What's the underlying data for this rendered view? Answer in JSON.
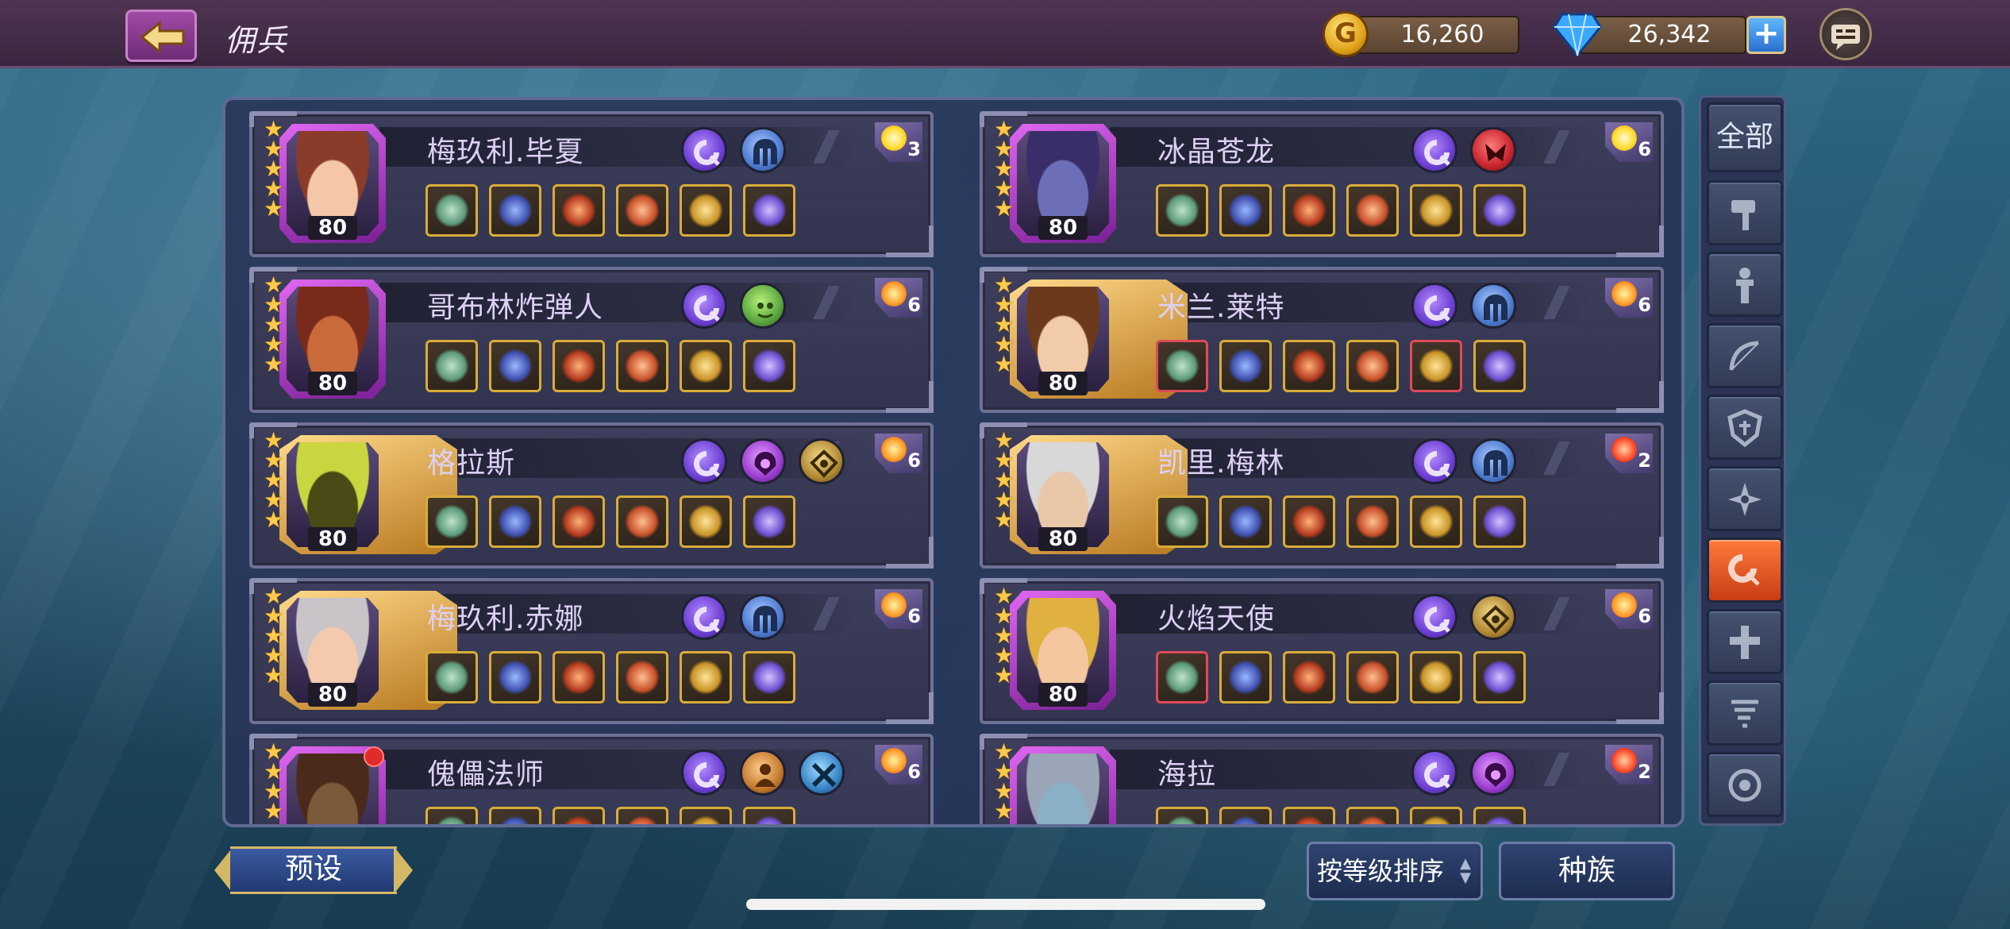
{
  "header": {
    "title": "佣兵",
    "gold": "16,260",
    "gems": "26,342",
    "plus_label": "+"
  },
  "heroes": [
    {
      "name": "梅玖利.毕夏",
      "level": "80",
      "stars": 5,
      "frame": "purple",
      "skin": "#f4c7a6",
      "hair": "#8a3b2a",
      "classes": [
        "purple",
        "blue"
      ],
      "badge": {
        "num": "3",
        "color": "yellow"
      },
      "equip_red": [],
      "dot": false
    },
    {
      "name": "冰晶苍龙",
      "level": "80",
      "stars": 5,
      "frame": "purple",
      "skin": "#6c6fb8",
      "hair": "#3a2e6a",
      "classes": [
        "purple",
        "red"
      ],
      "badge": {
        "num": "6",
        "color": "yellow"
      },
      "equip_red": [],
      "dot": false
    },
    {
      "name": "哥布林炸弹人",
      "level": "80",
      "stars": 5,
      "frame": "purple",
      "skin": "#c86a3a",
      "hair": "#7a2a1a",
      "classes": [
        "purple",
        "green"
      ],
      "badge": {
        "num": "6",
        "color": "orange"
      },
      "equip_red": [],
      "dot": false
    },
    {
      "name": "米兰.莱特",
      "level": "80",
      "stars": 5,
      "frame": "gold",
      "skin": "#f2cbaa",
      "hair": "#6b3a1c",
      "classes": [
        "purple",
        "blue"
      ],
      "badge": {
        "num": "6",
        "color": "orange"
      },
      "equip_red": [
        0,
        4
      ],
      "dot": false
    },
    {
      "name": "格拉斯",
      "level": "80",
      "stars": 5,
      "frame": "gold",
      "skin": "#4a4a16",
      "hair": "#c9d640",
      "classes": [
        "purple",
        "pink",
        "gold"
      ],
      "badge": {
        "num": "6",
        "color": "orange"
      },
      "equip_red": [],
      "dot": false
    },
    {
      "name": "凯里.梅林",
      "level": "80",
      "stars": 5,
      "frame": "gold",
      "skin": "#e8c8a8",
      "hair": "#d8d8d8",
      "classes": [
        "purple",
        "blue"
      ],
      "badge": {
        "num": "2",
        "color": "red"
      },
      "equip_red": [],
      "dot": false
    },
    {
      "name": "梅玖利.赤娜",
      "level": "80",
      "stars": 5,
      "frame": "gold",
      "skin": "#f4c9ae",
      "hair": "#c8c4c8",
      "classes": [
        "purple",
        "blue"
      ],
      "badge": {
        "num": "6",
        "color": "orange"
      },
      "equip_red": [],
      "dot": false
    },
    {
      "name": "火焰天使",
      "level": "80",
      "stars": 5,
      "frame": "purple",
      "skin": "#f4c7a0",
      "hair": "#e0b040",
      "classes": [
        "purple",
        "gold"
      ],
      "badge": {
        "num": "6",
        "color": "orange"
      },
      "equip_red": [
        0
      ],
      "dot": false
    },
    {
      "name": "傀儡法师",
      "level": "",
      "stars": 4,
      "frame": "purple",
      "skin": "#7a5a3a",
      "hair": "#4a2a1a",
      "classes": [
        "purple",
        "orange",
        "sky"
      ],
      "badge": {
        "num": "6",
        "color": "orange"
      },
      "equip_red": [],
      "dot": true
    },
    {
      "name": "海拉",
      "level": "",
      "stars": 4,
      "frame": "purple",
      "skin": "#8ab0c8",
      "hair": "#9aa6b8",
      "classes": [
        "purple",
        "pink"
      ],
      "badge": {
        "num": "2",
        "color": "red"
      },
      "equip_red": [],
      "dot": false
    }
  ],
  "filters": {
    "all_label": "全部",
    "icons": [
      "hammer-icon",
      "totem-icon",
      "bow-icon",
      "shield-icon",
      "shuriken-icon",
      "magic-icon",
      "cross-icon",
      "tornado-icon",
      "ring-icon"
    ],
    "active_index": 5
  },
  "footer": {
    "preset_label": "预设",
    "sort_label": "按等级排序",
    "race_label": "种族"
  }
}
